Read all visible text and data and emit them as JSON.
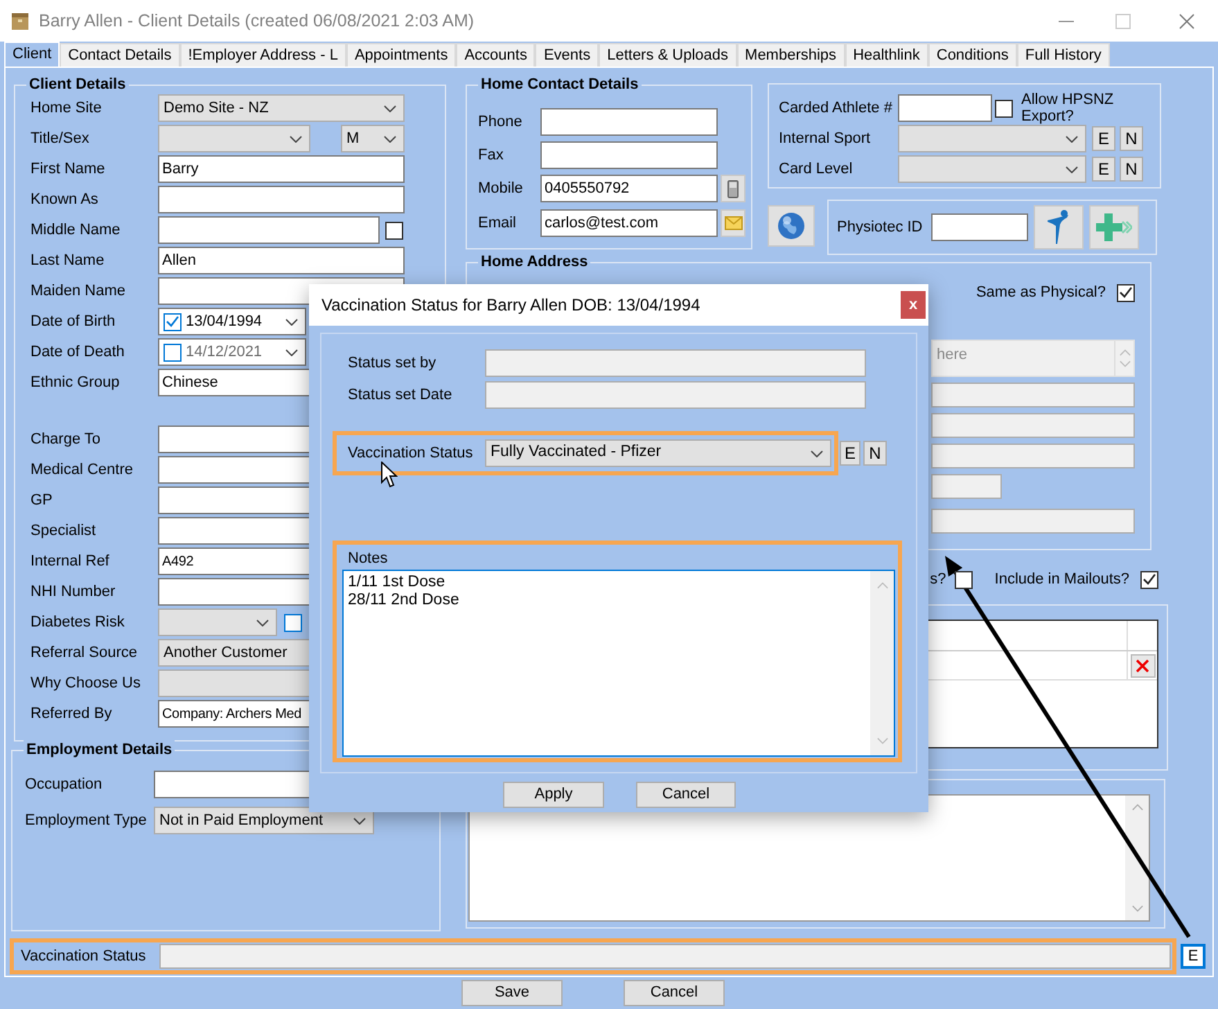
{
  "window": {
    "title": "Barry Allen - Client Details (created 06/08/2021 2:03 AM)"
  },
  "tabs": [
    {
      "label": "Client",
      "selected": true
    },
    {
      "label": "Contact Details",
      "selected": false
    },
    {
      "label": "!Employer Address - L",
      "selected": false
    },
    {
      "label": "Appointments",
      "selected": false
    },
    {
      "label": "Accounts",
      "selected": false
    },
    {
      "label": "Events",
      "selected": false
    },
    {
      "label": "Letters & Uploads",
      "selected": false
    },
    {
      "label": "Memberships",
      "selected": false
    },
    {
      "label": "Healthlink",
      "selected": false
    },
    {
      "label": "Conditions",
      "selected": false
    },
    {
      "label": "Full History",
      "selected": false
    }
  ],
  "client_details": {
    "title": "Client Details",
    "personal": [
      {
        "kind": "select",
        "label": "Home Site",
        "value": "Demo Site - NZ"
      },
      {
        "kind": "title_sex",
        "label": "Title/Sex",
        "sex": "M"
      },
      {
        "kind": "text",
        "label": "First Name",
        "value": "Barry"
      },
      {
        "kind": "text",
        "label": "Known As"
      },
      {
        "kind": "text_check",
        "label": "Middle Name",
        "checked": false
      },
      {
        "kind": "text",
        "label": "Last Name",
        "value": "Allen"
      },
      {
        "kind": "text",
        "label": "Maiden Name"
      },
      {
        "kind": "date",
        "label": "Date of Birth",
        "value": "13/04/1994",
        "checked": true
      },
      {
        "kind": "date",
        "label": "Date of Death",
        "value": "14/12/2021",
        "checked": false
      },
      {
        "kind": "text",
        "label": "Ethnic Group",
        "value": "Chinese"
      }
    ],
    "referral": [
      {
        "kind": "text",
        "label": "Charge To"
      },
      {
        "kind": "text",
        "label": "Medical Centre"
      },
      {
        "kind": "text",
        "label": "GP"
      },
      {
        "kind": "text",
        "label": "Specialist"
      },
      {
        "kind": "text",
        "label": "Internal Ref",
        "value": "A492"
      },
      {
        "kind": "text",
        "label": "NHI Number"
      },
      {
        "kind": "select_check",
        "label": "Diabetes Risk",
        "checked": false
      },
      {
        "kind": "select",
        "label": "Referral Source",
        "value": "Another Customer"
      },
      {
        "kind": "select",
        "label": "Why Choose Us"
      },
      {
        "kind": "text",
        "label": "Referred By",
        "value": "Company: Archers Med"
      }
    ]
  },
  "employment": {
    "title": "Employment Details",
    "rows": [
      {
        "kind": "text",
        "label": "Occupation"
      },
      {
        "kind": "select",
        "label": "Employment Type",
        "value": "Not in Paid Employment"
      }
    ]
  },
  "home_contact": {
    "title": "Home Contact Details",
    "rows": [
      {
        "kind": "text",
        "label": "Phone"
      },
      {
        "kind": "text",
        "label": "Fax"
      },
      {
        "kind": "phone",
        "label": "Mobile",
        "value": "0405550792"
      },
      {
        "kind": "email",
        "label": "Email",
        "value": "carlos@test.com"
      }
    ]
  },
  "athlete": {
    "carded_label": "Carded Athlete #",
    "hpsnz": {
      "label": "Allow HPSNZ Export?",
      "checked": false
    },
    "rows": [
      {
        "label": "Internal Sport",
        "edit": "E",
        "new": "N"
      },
      {
        "label": "Card Level",
        "edit": "E",
        "new": "N"
      }
    ]
  },
  "physiotec": {
    "label": "Physiotec ID"
  },
  "home_address": {
    "title": "Home Address",
    "same_as_physical": {
      "label": "Same as Physical?",
      "checked": true
    },
    "address_text": "here"
  },
  "options": [
    {
      "label": "s?",
      "checked": false
    },
    {
      "label": "Include in Mailouts?",
      "checked": true
    }
  ],
  "vaccination_bar": {
    "label": "Vaccination Status",
    "edit": "E"
  },
  "footer_buttons": [
    "Save",
    "Cancel"
  ],
  "dialog": {
    "title": "Vaccination Status for Barry Allen DOB: 13/04/1994",
    "close": "x",
    "status_set_by_label": "Status set by",
    "status_set_date_label": "Status set Date",
    "vaccination": {
      "label": "Vaccination Status",
      "value": "Fully Vaccinated - Pfizer",
      "edit": "E",
      "new": "N"
    },
    "notes": {
      "label": "Notes",
      "lines": [
        "1/11 1st Dose",
        "28/11 2nd Dose"
      ]
    },
    "buttons": [
      "Apply",
      "Cancel"
    ]
  }
}
